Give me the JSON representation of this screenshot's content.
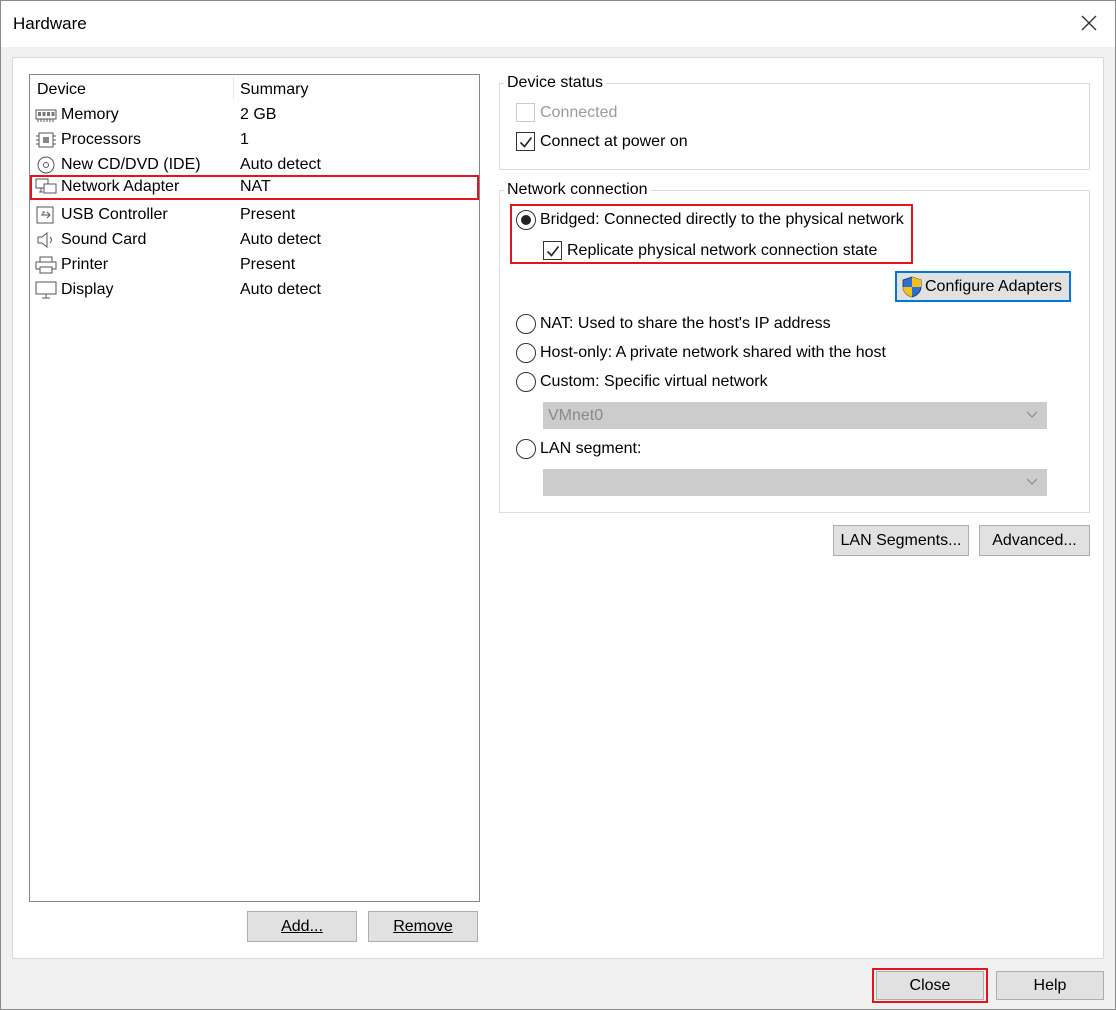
{
  "window": {
    "title": "Hardware"
  },
  "device_list": {
    "headers": {
      "device": "Device",
      "summary": "Summary"
    },
    "rows": [
      {
        "name": "Memory",
        "summary": "2 GB",
        "icon": "memory-icon"
      },
      {
        "name": "Processors",
        "summary": "1",
        "icon": "processor-icon"
      },
      {
        "name": "New CD/DVD (IDE)",
        "summary": "Auto detect",
        "icon": "cd-dvd-icon"
      },
      {
        "name": "Network Adapter",
        "summary": "NAT",
        "icon": "network-adapter-icon",
        "selected": true
      },
      {
        "name": "USB Controller",
        "summary": "Present",
        "icon": "usb-icon"
      },
      {
        "name": "Sound Card",
        "summary": "Auto detect",
        "icon": "speaker-icon"
      },
      {
        "name": "Printer",
        "summary": "Present",
        "icon": "printer-icon"
      },
      {
        "name": "Display",
        "summary": "Auto detect",
        "icon": "monitor-icon"
      }
    ],
    "add_button": "Add...",
    "remove_button": "Remove"
  },
  "device_status": {
    "label": "Device status",
    "connected": {
      "label": "Connected",
      "checked": false,
      "enabled": false
    },
    "connect_at_power_on": {
      "label": "Connect at power on",
      "checked": true
    }
  },
  "network_connection": {
    "label": "Network connection",
    "bridged": {
      "label": "Bridged: Connected directly to the physical network",
      "selected": true
    },
    "replicate": {
      "label": "Replicate physical network connection state",
      "checked": true
    },
    "configure_adapters": "Configure Adapters",
    "nat": {
      "label": "NAT: Used to share the host's IP address"
    },
    "host_only": {
      "label": "Host-only: A private network shared with the host"
    },
    "custom": {
      "label": "Custom: Specific virtual network",
      "select_value": "VMnet0"
    },
    "lan_segment": {
      "label": "LAN segment:",
      "select_value": ""
    }
  },
  "buttons": {
    "lan_segments": "LAN Segments...",
    "advanced": "Advanced...",
    "close": "Close",
    "help": "Help"
  },
  "colors": {
    "highlight": "#e0161b",
    "button_face": "#e1e1e1",
    "focus_blue": "#0078d7"
  }
}
